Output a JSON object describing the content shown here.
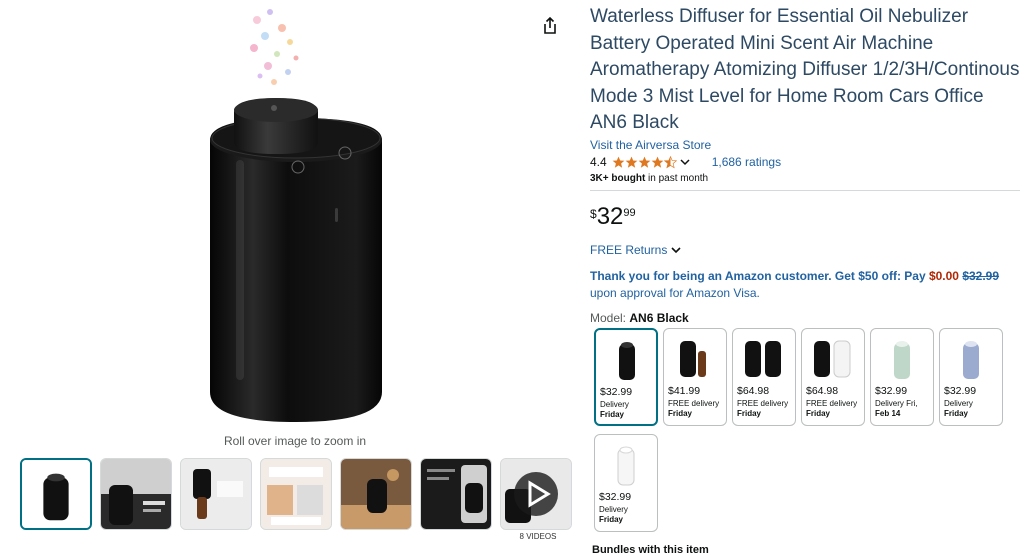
{
  "product": {
    "title": "Waterless Diffuser for Essential Oil Nebulizer Battery Operated Mini Scent Air Machine Aromatherapy Atomizing Diffuser 1/2/3H/Continous Mode 3 Mist Level for Home Room Cars Office AN6 Black",
    "store_link": "Visit the Airversa Store",
    "rating": "4.4",
    "rating_count": "1,686 ratings",
    "bought_bold": "3K+ bought",
    "bought_rest": " in past month"
  },
  "price": {
    "symbol": "$",
    "whole": "32",
    "fraction": "99"
  },
  "returns": {
    "label": "FREE Returns"
  },
  "offer": {
    "lead": "Thank you for being an Amazon customer. Get $50 off: Pay ",
    "pay": "$0.00",
    "space": " ",
    "was": "$32.99",
    "tail": " upon approval for Amazon Visa."
  },
  "model": {
    "label": "Model: ",
    "value": "AN6 Black"
  },
  "swatches": [
    {
      "price": "$32.99",
      "line1": "Delivery",
      "line2": "Friday"
    },
    {
      "price": "$41.99",
      "line1": "FREE delivery",
      "line2": "Friday"
    },
    {
      "price": "$64.98",
      "line1": "FREE delivery",
      "line2": "Friday"
    },
    {
      "price": "$64.98",
      "line1": "FREE delivery",
      "line2": "Friday"
    },
    {
      "price": "$32.99",
      "line1": "Delivery Fri,",
      "line2": "Feb 14"
    },
    {
      "price": "$32.99",
      "line1": "Delivery",
      "line2": "Friday"
    },
    {
      "price": "$32.99",
      "line1": "Delivery",
      "line2": "Friday"
    }
  ],
  "gallery": {
    "zoom_hint": "Roll over image to zoom in",
    "video_count": "8 VIDEOS"
  },
  "bundles": {
    "label": "Bundles with this item"
  },
  "colors": {
    "link": "#2162a1",
    "title": "#2d4963",
    "price_red": "#b12704",
    "star": "#de7921",
    "selected": "#007185"
  },
  "icons": [
    "share-icon",
    "star-icon",
    "chevron-down-icon",
    "play-icon"
  ]
}
